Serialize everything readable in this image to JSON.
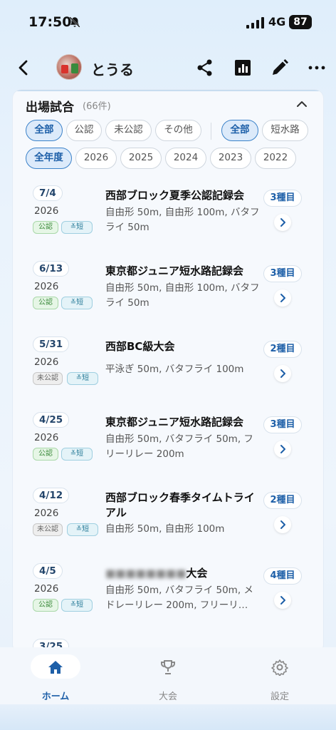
{
  "status": {
    "time": "17:50",
    "network": "4G",
    "battery": "87"
  },
  "header": {
    "user_name": "とうる"
  },
  "section": {
    "title": "出場試合",
    "count": "(66件)"
  },
  "filters": {
    "official": [
      "全部",
      "公認",
      "未公認",
      "その他"
    ],
    "pool": [
      "全部",
      "短水路"
    ],
    "years": [
      "全年度",
      "2026",
      "2025",
      "2024",
      "2023",
      "2022"
    ]
  },
  "matches": [
    {
      "date": "7/4",
      "year": "2026",
      "status": "公認",
      "pool": "≚短",
      "title": "西部ブロック夏季公認記録会",
      "events": "自由形 50m, 自由形 100m, バタフライ 50m",
      "kind": "3種目"
    },
    {
      "date": "6/13",
      "year": "2026",
      "status": "公認",
      "pool": "≚短",
      "title": "東京都ジュニア短水路記録会",
      "events": "自由形 50m, 自由形 100m, バタフライ 50m",
      "kind": "3種目"
    },
    {
      "date": "5/31",
      "year": "2026",
      "status": "未公認",
      "pool": "≚短",
      "title": "西部BC級大会",
      "events": "平泳ぎ 50m, バタフライ 100m",
      "kind": "2種目"
    },
    {
      "date": "4/25",
      "year": "2026",
      "status": "公認",
      "pool": "≚短",
      "title": "東京都ジュニア短水路記録会",
      "events": "自由形 50m, バタフライ 50m, フリーリレー 200m",
      "kind": "3種目"
    },
    {
      "date": "4/12",
      "year": "2026",
      "status": "未公認",
      "pool": "≚短",
      "title": "西部ブロック春季タイムトライアル",
      "events": "自由形 50m, 自由形 100m",
      "kind": "2種目"
    },
    {
      "date": "4/5",
      "year": "2026",
      "status": "公認",
      "pool": "≚短",
      "title": "大会",
      "events": "自由形 50m, バタフライ 50m, メドレーリレー 200m, フリーリ…",
      "kind": "4種目"
    },
    {
      "date": "3/25",
      "year": "",
      "status": "",
      "pool": "",
      "title": "",
      "events": "",
      "kind": ""
    }
  ],
  "nav": [
    {
      "label": "ホーム",
      "icon": "home-icon",
      "active": true
    },
    {
      "label": "大会",
      "icon": "trophy-icon",
      "active": false
    },
    {
      "label": "設定",
      "icon": "gear-icon",
      "active": false
    }
  ],
  "colors": {
    "accent": "#1d5fa8",
    "accent_bg": "#dceafa",
    "official": "#3b8a3b",
    "short": "#2b7d9a"
  }
}
